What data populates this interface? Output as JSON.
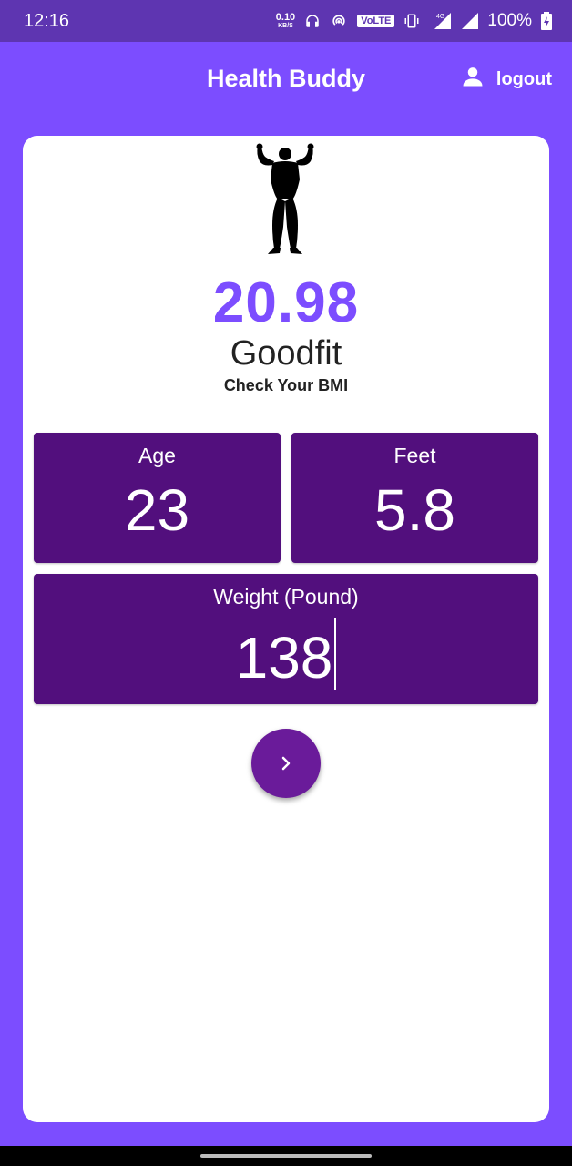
{
  "status_bar": {
    "time": "12:16",
    "net_speed_value": "0.10",
    "net_speed_unit": "KB/S",
    "volte": "VoLTE",
    "network_type": "4G",
    "battery": "100%"
  },
  "app_bar": {
    "title": "Health Buddy",
    "logout_label": "logout"
  },
  "result": {
    "bmi_value": "20.98",
    "status": "Goodfit",
    "subtitle": "Check Your BMI"
  },
  "inputs": {
    "age_label": "Age",
    "age_value": "23",
    "feet_label": "Feet",
    "feet_value": "5.8",
    "weight_label": "Weight (Pound)",
    "weight_value": "138"
  },
  "colors": {
    "background": "#7c4dff",
    "status_bar": "#5e35b1",
    "accent": "#7c4dff",
    "input_box": "#520f7d",
    "button": "#6a1b9a"
  },
  "icons": {
    "figure": "bodybuilder-icon",
    "user": "person-icon",
    "next": "chevron-right-icon"
  }
}
